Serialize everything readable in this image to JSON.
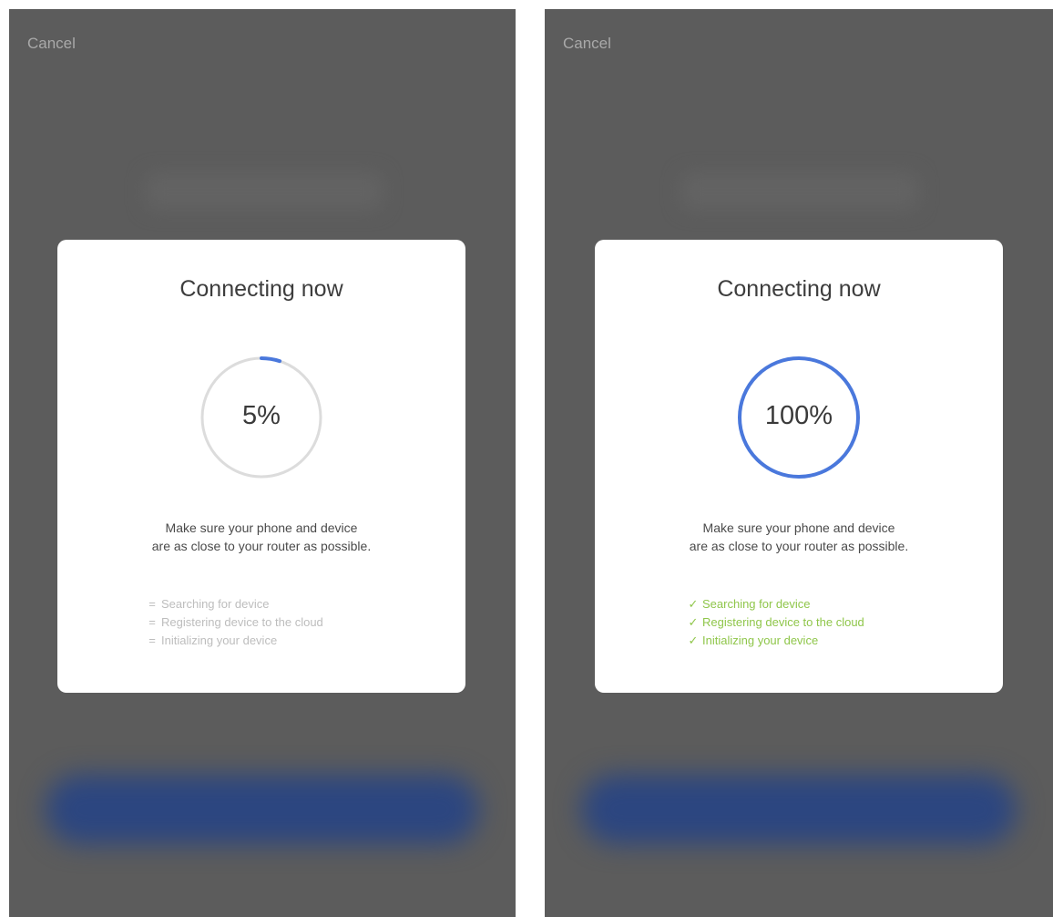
{
  "left": {
    "cancel_label": "Cancel",
    "card": {
      "title": "Connecting now",
      "progress_text": "5%",
      "progress": 0.05,
      "note_line1": "Make sure your phone and device",
      "note_line2": "are as close to your router as possible.",
      "steps": [
        {
          "mark": "=",
          "label": "Searching for device",
          "state": "pending"
        },
        {
          "mark": "=",
          "label": "Registering device to the cloud",
          "state": "pending"
        },
        {
          "mark": "=",
          "label": "Initializing your device",
          "state": "pending"
        }
      ]
    }
  },
  "right": {
    "cancel_label": "Cancel",
    "card": {
      "title": "Connecting now",
      "progress_text": "100%",
      "progress": 1.0,
      "note_line1": "Make sure your phone and device",
      "note_line2": "are as close to your router as possible.",
      "steps": [
        {
          "mark": "✓",
          "label": "Searching for device",
          "state": "done"
        },
        {
          "mark": "✓",
          "label": "Registering device to the cloud",
          "state": "done"
        },
        {
          "mark": "✓",
          "label": "Initializing your device",
          "state": "done"
        }
      ]
    }
  },
  "colors": {
    "ring_track": "#dcdcdc",
    "ring_progress": "#4a78dc",
    "step_pending": "#bdbdbd",
    "step_done": "#8fc64a",
    "overlay": "#5c5c5c",
    "primary_button_blur": "#2c4680"
  }
}
